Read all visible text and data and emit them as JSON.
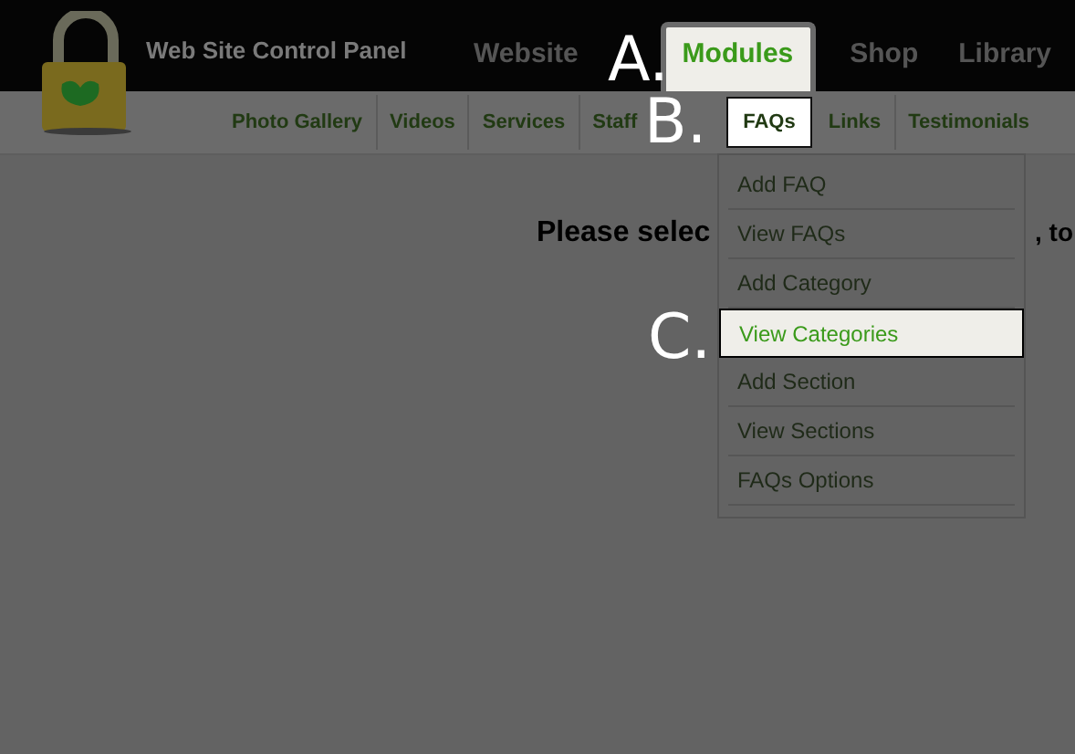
{
  "header": {
    "title": "Web Site Control Panel"
  },
  "top_nav": [
    {
      "label": "Website",
      "selected": false
    },
    {
      "label": "Modules",
      "selected": true
    },
    {
      "label": "Shop",
      "selected": false
    },
    {
      "label": "Library",
      "selected": false
    }
  ],
  "sub_nav": [
    {
      "label": "Photo Gallery",
      "selected": false
    },
    {
      "label": "Videos",
      "selected": false
    },
    {
      "label": "Services",
      "selected": false
    },
    {
      "label": "Staff",
      "selected": false
    },
    {
      "label": "FAQs",
      "selected": true
    },
    {
      "label": "Links",
      "selected": false
    },
    {
      "label": "Testimonials",
      "selected": false
    }
  ],
  "dropdown": [
    {
      "label": "Add FAQ",
      "selected": false
    },
    {
      "label": "View FAQs",
      "selected": false
    },
    {
      "label": "Add Category",
      "selected": false
    },
    {
      "label": "View Categories",
      "selected": true
    },
    {
      "label": "Add Section",
      "selected": false
    },
    {
      "label": "View Sections",
      "selected": false
    },
    {
      "label": "FAQs Options",
      "selected": false
    }
  ],
  "content": {
    "heading_parts": [
      "Please selec",
      ", to"
    ]
  },
  "annotations": [
    "A.",
    "B.",
    "C."
  ]
}
